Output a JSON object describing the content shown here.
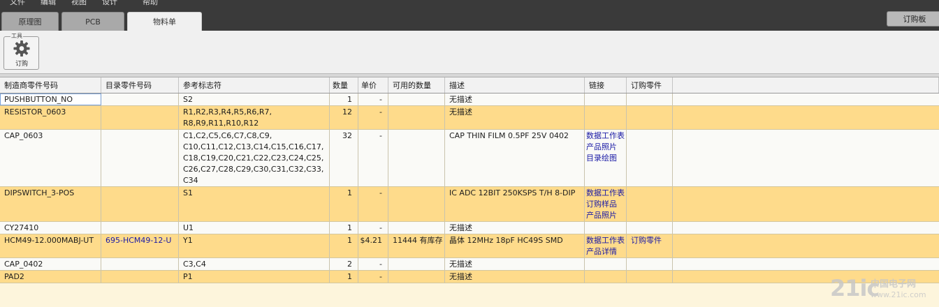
{
  "menu": [
    "文件",
    "编辑",
    "视图",
    "设计",
    "帮助"
  ],
  "tabs": [
    {
      "label": "原理图",
      "active": false
    },
    {
      "label": "PCB",
      "active": false
    },
    {
      "label": "物料单",
      "active": true
    }
  ],
  "order_board_label": "订购板",
  "toolbar": {
    "group_label": "工具",
    "order_label": "订购",
    "gear_icon": "gear-icon"
  },
  "table": {
    "headers": [
      "制造商零件号码",
      "目录零件号码",
      "参考标志符",
      "数量",
      "单价",
      "可用的数量",
      "描述",
      "链接",
      "订购零件"
    ],
    "rows": [
      {
        "mfr": "PUSHBUTTON_NO",
        "catalog": "",
        "refs": "S2",
        "qty": "1",
        "price": "-",
        "avail": "",
        "desc": "无描述",
        "links": [],
        "order": "",
        "style": "white",
        "selected": true
      },
      {
        "mfr": "RESISTOR_0603",
        "catalog": "",
        "refs": "R1,R2,R3,R4,R5,R6,R7,\nR8,R9,R11,R10,R12",
        "qty": "12",
        "price": "-",
        "avail": "",
        "desc": "无描述",
        "links": [],
        "order": "",
        "style": "orange"
      },
      {
        "mfr": "CAP_0603",
        "catalog": "",
        "refs": "C1,C2,C5,C6,C7,C8,C9,\nC10,C11,C12,C13,C14,C15,C16,C17,\nC18,C19,C20,C21,C22,C23,C24,C25,\nC26,C27,C28,C29,C30,C31,C32,C33,\nC34",
        "qty": "32",
        "price": "-",
        "avail": "",
        "desc": "CAP THIN FILM 0.5PF 25V 0402",
        "links": [
          "数据工作表",
          "产品照片",
          "目录绘图"
        ],
        "order": "",
        "style": "white"
      },
      {
        "mfr": "DIPSWITCH_3-POS",
        "catalog": "",
        "refs": "S1",
        "qty": "1",
        "price": "-",
        "avail": "",
        "desc": "IC ADC 12BIT 250KSPS T/H 8-DIP",
        "links": [
          "数据工作表",
          "订购样品",
          "产品照片"
        ],
        "order": "",
        "style": "orange"
      },
      {
        "mfr": "CY27410",
        "catalog": "",
        "refs": "U1",
        "qty": "1",
        "price": "-",
        "avail": "",
        "desc": "无描述",
        "links": [],
        "order": "",
        "style": "white"
      },
      {
        "mfr": "HCM49-12.000MABJ-UT",
        "catalog": "695-HCM49-12-U",
        "refs": "Y1",
        "qty": "1",
        "price": "$4.21",
        "avail": "11444 有库存",
        "desc": "晶体 12MHz 18pF HC49S SMD",
        "links": [
          "数据工作表",
          "产品详情"
        ],
        "order": "订购零件",
        "style": "orange"
      },
      {
        "mfr": "CAP_0402",
        "catalog": "",
        "refs": "C3,C4",
        "qty": "2",
        "price": "-",
        "avail": "",
        "desc": "无描述",
        "links": [],
        "order": "",
        "style": "white"
      },
      {
        "mfr": "PAD2",
        "catalog": "",
        "refs": "P1",
        "qty": "1",
        "price": "-",
        "avail": "",
        "desc": "无描述",
        "links": [],
        "order": "",
        "style": "orange"
      }
    ]
  },
  "watermark": {
    "big": "21ic",
    "small": "中国电子网",
    "tiny": "www.21ic.com"
  }
}
